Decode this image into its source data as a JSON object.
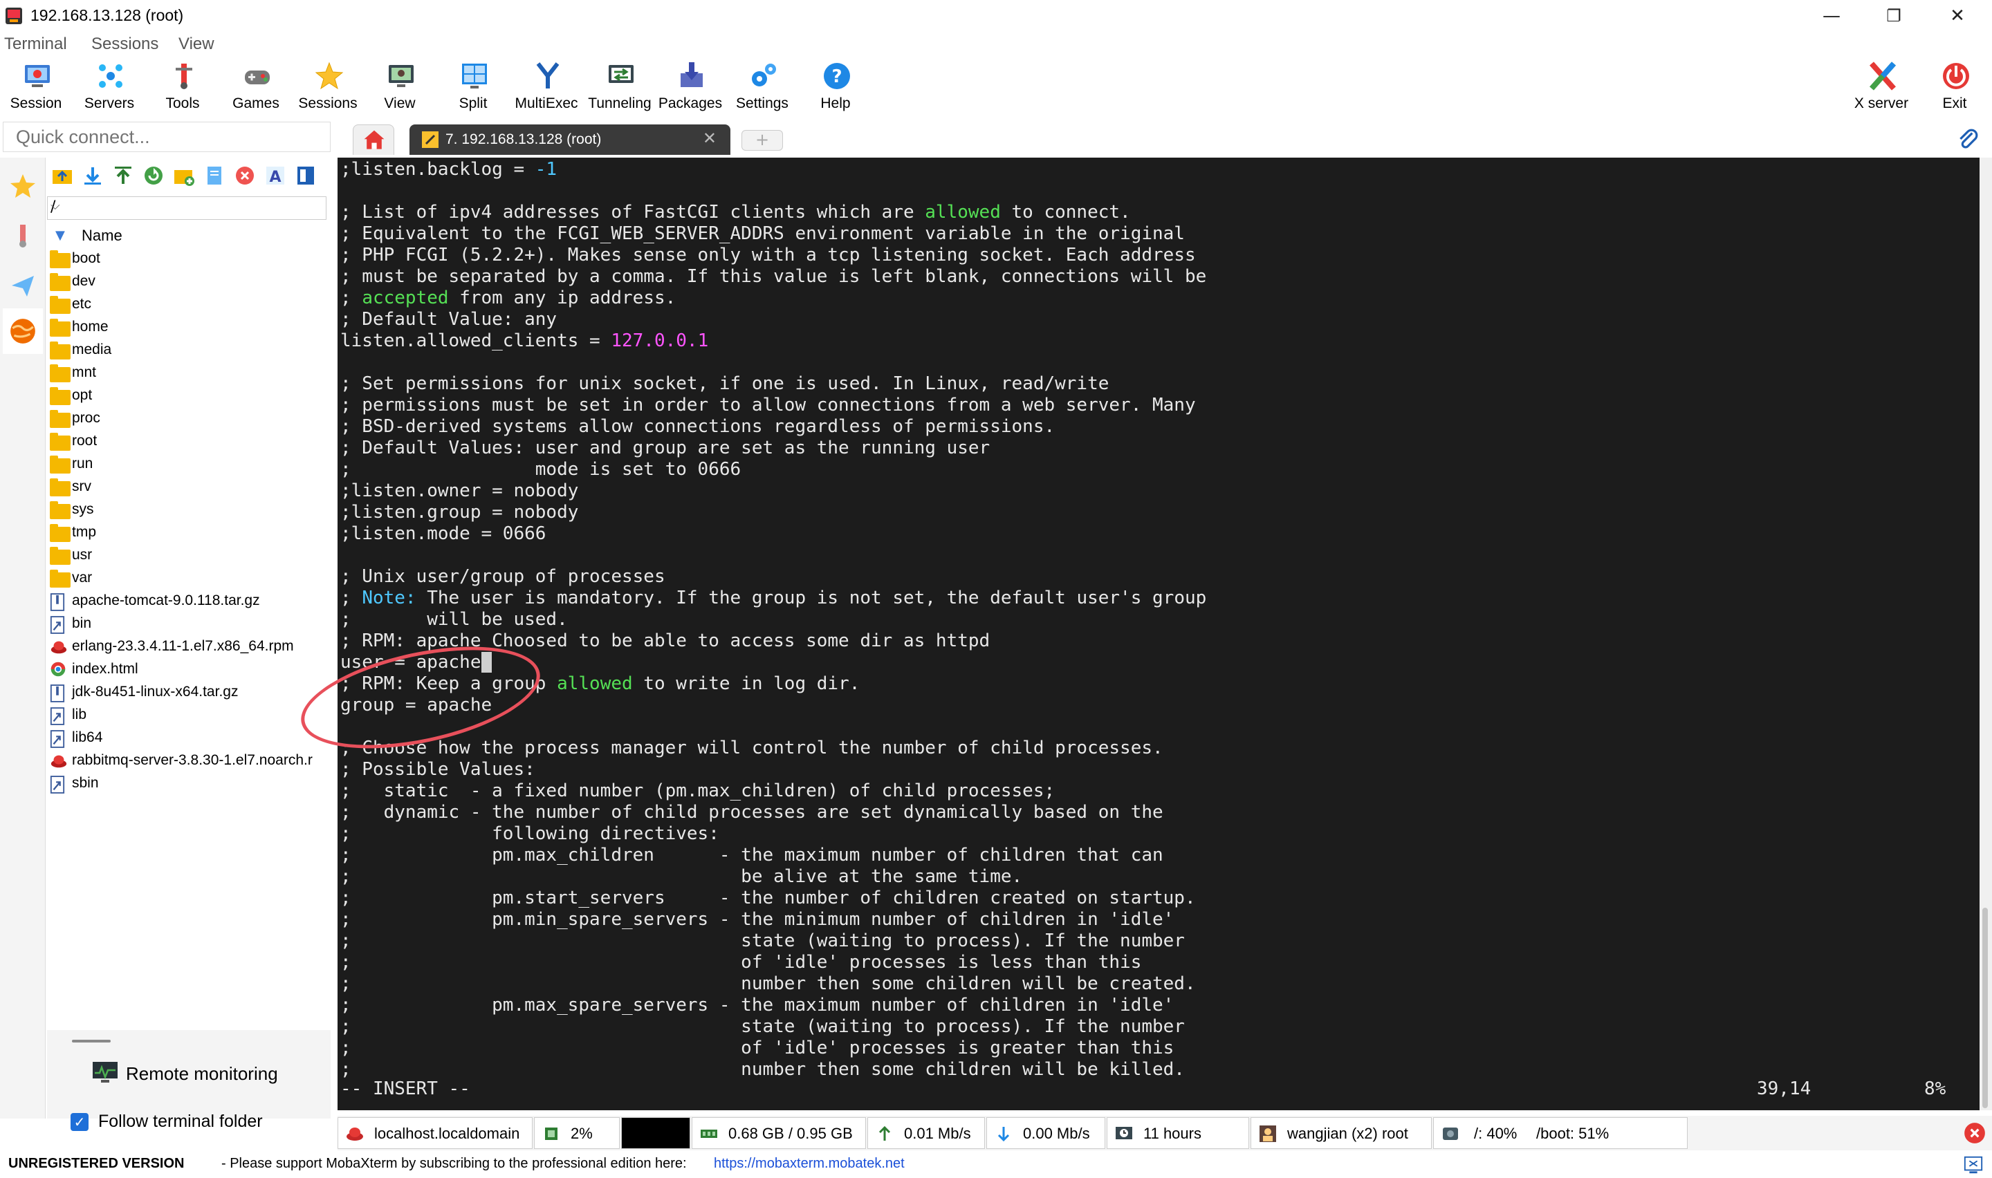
{
  "window": {
    "title": "192.168.13.128 (root)",
    "minimize": "—",
    "restore": "❐",
    "close": "✕"
  },
  "menu": [
    "Terminal",
    "Sessions",
    "View"
  ],
  "toolbar": [
    {
      "label": "Session",
      "icon": "session-icon"
    },
    {
      "label": "Servers",
      "icon": "servers-icon"
    },
    {
      "label": "Tools",
      "icon": "tools-icon"
    },
    {
      "label": "Games",
      "icon": "games-icon"
    },
    {
      "label": "Sessions",
      "icon": "star-icon"
    },
    {
      "label": "View",
      "icon": "view-icon"
    },
    {
      "label": "Split",
      "icon": "split-icon"
    },
    {
      "label": "MultiExec",
      "icon": "multiexec-icon"
    },
    {
      "label": "Tunneling",
      "icon": "tunneling-icon"
    },
    {
      "label": "Packages",
      "icon": "packages-icon"
    },
    {
      "label": "Settings",
      "icon": "settings-icon"
    },
    {
      "label": "Help",
      "icon": "help-icon"
    }
  ],
  "toolbar_right": [
    {
      "label": "X server",
      "icon": "xserver-icon"
    },
    {
      "label": "Exit",
      "icon": "exit-icon"
    }
  ],
  "quick_connect": {
    "placeholder": "Quick connect..."
  },
  "tabs": {
    "session_tab": "7. 192.168.13.128 (root)",
    "close": "✕",
    "new_tab": "+"
  },
  "sftp": {
    "path": "/",
    "column_name": "Name",
    "files": [
      {
        "name": "boot",
        "type": "folder"
      },
      {
        "name": "dev",
        "type": "folder"
      },
      {
        "name": "etc",
        "type": "folder"
      },
      {
        "name": "home",
        "type": "folder"
      },
      {
        "name": "media",
        "type": "folder"
      },
      {
        "name": "mnt",
        "type": "folder"
      },
      {
        "name": "opt",
        "type": "folder"
      },
      {
        "name": "proc",
        "type": "folder"
      },
      {
        "name": "root",
        "type": "folder"
      },
      {
        "name": "run",
        "type": "folder"
      },
      {
        "name": "srv",
        "type": "folder"
      },
      {
        "name": "sys",
        "type": "folder"
      },
      {
        "name": "tmp",
        "type": "folder"
      },
      {
        "name": "usr",
        "type": "folder"
      },
      {
        "name": "var",
        "type": "folder"
      },
      {
        "name": "apache-tomcat-9.0.118.tar.gz",
        "type": "archive"
      },
      {
        "name": "bin",
        "type": "link"
      },
      {
        "name": "erlang-23.3.4.11-1.el7.x86_64.rpm",
        "type": "rpm"
      },
      {
        "name": "index.html",
        "type": "html"
      },
      {
        "name": "jdk-8u451-linux-x64.tar.gz",
        "type": "archive"
      },
      {
        "name": "lib",
        "type": "link"
      },
      {
        "name": "lib64",
        "type": "link"
      },
      {
        "name": "rabbitmq-server-3.8.30-1.el7.noarch.r",
        "type": "rpm"
      },
      {
        "name": "sbin",
        "type": "link"
      }
    ],
    "remote_monitoring": "Remote monitoring",
    "follow_terminal_folder": "Follow terminal folder"
  },
  "terminal": {
    "lines": [
      [
        {
          "t": ";listen.backlog = "
        },
        {
          "t": "-1",
          "c": "c"
        }
      ],
      [
        {
          "t": ""
        }
      ],
      [
        {
          "t": "; List of ipv4 addresses of FastCGI clients which are "
        },
        {
          "t": "allowed",
          "c": "g"
        },
        {
          "t": " to connect."
        }
      ],
      [
        {
          "t": "; Equivalent to the FCGI_WEB_SERVER_ADDRS environment variable in the original"
        }
      ],
      [
        {
          "t": "; PHP FCGI (5.2.2+). Makes sense only with a tcp listening socket. Each address"
        }
      ],
      [
        {
          "t": "; must be separated by a comma. If this value is left blank, connections will be"
        }
      ],
      [
        {
          "t": "; "
        },
        {
          "t": "accepted",
          "c": "g"
        },
        {
          "t": " from any ip address."
        }
      ],
      [
        {
          "t": "; Default Value: any"
        }
      ],
      [
        {
          "t": "listen.allowed_clients = "
        },
        {
          "t": "127.0.0.1",
          "c": "m"
        }
      ],
      [
        {
          "t": ""
        }
      ],
      [
        {
          "t": "; Set permissions for unix socket, if one is used. In Linux, read/write"
        }
      ],
      [
        {
          "t": "; permissions must be set in order to allow connections from a web server. Many"
        }
      ],
      [
        {
          "t": "; BSD-derived systems allow connections regardless of permissions."
        }
      ],
      [
        {
          "t": "; Default Values: user and group are set as the running user"
        }
      ],
      [
        {
          "t": ";                 mode is set to 0666"
        }
      ],
      [
        {
          "t": ";listen.owner = nobody"
        }
      ],
      [
        {
          "t": ";listen.group = nobody"
        }
      ],
      [
        {
          "t": ";listen.mode = 0666"
        }
      ],
      [
        {
          "t": ""
        }
      ],
      [
        {
          "t": "; Unix user/group of processes"
        }
      ],
      [
        {
          "t": "; "
        },
        {
          "t": "Note:",
          "c": "c"
        },
        {
          "t": " The user is mandatory. If the group is not set, the default user's group"
        }
      ],
      [
        {
          "t": ";       will be used."
        }
      ],
      [
        {
          "t": "; RPM: apache Choosed to be able to access some dir as httpd"
        }
      ],
      [
        {
          "t": "user = apache"
        },
        {
          "t": " ",
          "c": "cursor"
        }
      ],
      [
        {
          "t": "; RPM: Keep a group "
        },
        {
          "t": "allowed",
          "c": "g"
        },
        {
          "t": " to write in log dir."
        }
      ],
      [
        {
          "t": "group = apache"
        }
      ],
      [
        {
          "t": ""
        }
      ],
      [
        {
          "t": "; Choose how the process manager will control the number of child processes."
        }
      ],
      [
        {
          "t": "; Possible Values:"
        }
      ],
      [
        {
          "t": ";   static  - a fixed number (pm.max_children) of child processes;"
        }
      ],
      [
        {
          "t": ";   dynamic - the number of child processes are set dynamically based on the"
        }
      ],
      [
        {
          "t": ";             following directives:"
        }
      ],
      [
        {
          "t": ";             pm.max_children      - the maximum number of children that can"
        }
      ],
      [
        {
          "t": ";                                    be alive at the same time."
        }
      ],
      [
        {
          "t": ";             pm.start_servers     - the number of children created on startup."
        }
      ],
      [
        {
          "t": ";             pm.min_spare_servers - the minimum number of children in 'idle'"
        }
      ],
      [
        {
          "t": ";                                    state (waiting to process). If the number"
        }
      ],
      [
        {
          "t": ";                                    of 'idle' processes is less than this"
        }
      ],
      [
        {
          "t": ";                                    number then some children will be created."
        }
      ],
      [
        {
          "t": ";             pm.max_spare_servers - the maximum number of children in 'idle'"
        }
      ],
      [
        {
          "t": ";                                    state (waiting to process). If the number"
        }
      ],
      [
        {
          "t": ";                                    of 'idle' processes is greater than this"
        }
      ],
      [
        {
          "t": ";                                    number then some children will be killed."
        }
      ]
    ],
    "mode": "-- INSERT --",
    "position": "39,14",
    "percent": "8%"
  },
  "statusbar": {
    "host": "localhost.localdomain",
    "cpu": "2%",
    "memory": "0.68 GB / 0.95 GB",
    "upload": "0.01 Mb/s",
    "download": "0.00 Mb/s",
    "uptime": "11 hours",
    "users": "wangjian (x2)  root",
    "disk_root": "/: 40%",
    "disk_boot": "/boot: 51%"
  },
  "bottombar": {
    "unregistered": "UNREGISTERED VERSION",
    "support": "-  Please support MobaXterm by subscribing to the professional edition here:",
    "link": "https://mobaxterm.mobatek.net"
  },
  "colors": {
    "terminal_bg": "#1c1c1c",
    "terminal_fg": "#e8e8e8",
    "green": "#55e055",
    "cyan": "#4fc8ff",
    "magenta": "#ff55ff",
    "annotation_circle": "#e8505b"
  }
}
